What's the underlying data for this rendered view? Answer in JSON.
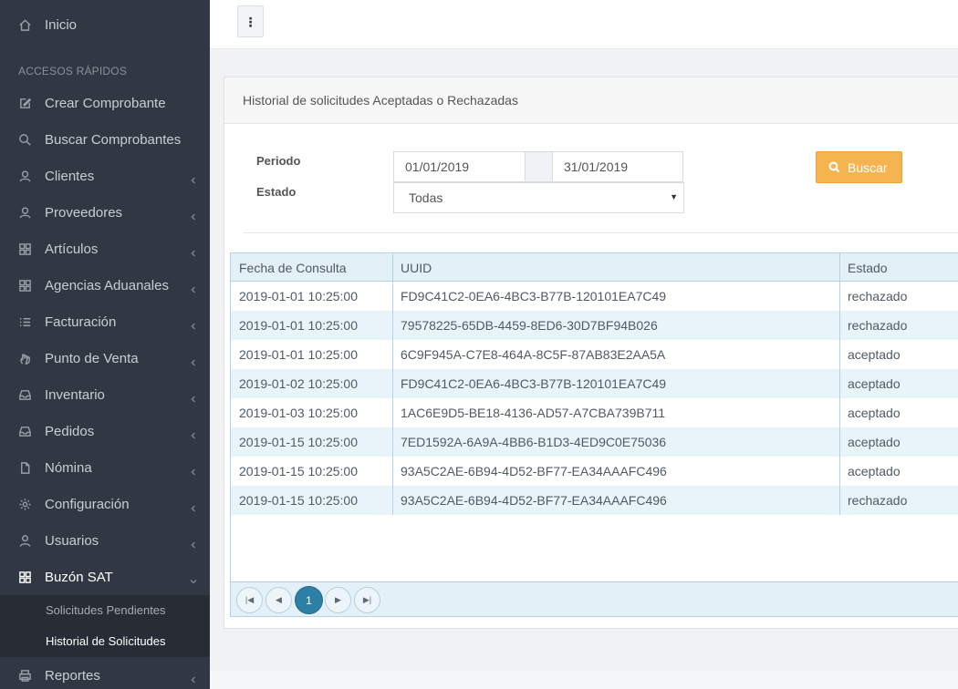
{
  "sidebar": {
    "top_item": {
      "label": "Inicio",
      "icon": "home-icon"
    },
    "section_title": "ACCESOS RÁPIDOS",
    "items": [
      {
        "label": "Crear Comprobante",
        "icon": "edit-icon",
        "chevron": false
      },
      {
        "label": "Buscar Comprobantes",
        "icon": "search-icon",
        "chevron": false
      },
      {
        "label": "Clientes",
        "icon": "users-icon",
        "chevron": true
      },
      {
        "label": "Proveedores",
        "icon": "users-icon",
        "chevron": true
      },
      {
        "label": "Artículos",
        "icon": "grid-icon",
        "chevron": true
      },
      {
        "label": "Agencias Aduanales",
        "icon": "grid-icon",
        "chevron": true
      },
      {
        "label": "Facturación",
        "icon": "list-icon",
        "chevron": true
      },
      {
        "label": "Punto de Venta",
        "icon": "hand-icon",
        "chevron": true
      },
      {
        "label": "Inventario",
        "icon": "inbox-icon",
        "chevron": true
      },
      {
        "label": "Pedidos",
        "icon": "inbox-icon",
        "chevron": true
      },
      {
        "label": "Nómina",
        "icon": "file-icon",
        "chevron": true
      },
      {
        "label": "Configuración",
        "icon": "gear-icon",
        "chevron": true
      },
      {
        "label": "Usuarios",
        "icon": "user-icon",
        "chevron": true
      },
      {
        "label": "Buzón SAT",
        "icon": "grid-icon",
        "chevron": true,
        "expanded": true
      }
    ],
    "submenu": [
      {
        "label": "Solicitudes Pendientes",
        "active": false
      },
      {
        "label": "Historial de Solicitudes",
        "active": true
      }
    ],
    "bottom_item": {
      "label": "Reportes",
      "icon": "printer-icon"
    }
  },
  "topbar": {
    "menu_icon": "vertical-dots-icon"
  },
  "panel": {
    "title": "Historial de solicitudes Aceptadas o Rechazadas",
    "form": {
      "periodo_label": "Periodo",
      "estado_label": "Estado",
      "fecha_inicio": "01/01/2019",
      "fecha_fin": "31/01/2019",
      "estado_value": "Todas",
      "search_button": "Buscar",
      "button_color": "#f6b451"
    },
    "table": {
      "columns": [
        "Fecha de Consulta",
        "UUID",
        "Estado"
      ],
      "rows": [
        [
          "2019-01-01 10:25:00",
          "FD9C41C2-0EA6-4BC3-B77B-120101EA7C49",
          "rechazado"
        ],
        [
          "2019-01-01 10:25:00",
          "79578225-65DB-4459-8ED6-30D7BF94B026",
          "rechazado"
        ],
        [
          "2019-01-01 10:25:00",
          "6C9F945A-C7E8-464A-8C5F-87AB83E2AA5A",
          "aceptado"
        ],
        [
          "2019-01-02 10:25:00",
          "FD9C41C2-0EA6-4BC3-B77B-120101EA7C49",
          "aceptado"
        ],
        [
          "2019-01-03 10:25:00",
          "1AC6E9D5-BE18-4136-AD57-A7CBA739B711",
          "aceptado"
        ],
        [
          "2019-01-15 10:25:00",
          "7ED1592A-6A9A-4BB6-B1D3-4ED9C0E75036",
          "aceptado"
        ],
        [
          "2019-01-15 10:25:00",
          "93A5C2AE-6B94-4D52-BF77-EA34AAAFC496",
          "aceptado"
        ],
        [
          "2019-01-15 10:25:00",
          "93A5C2AE-6B94-4D52-BF77-EA34AAAFC496",
          "rechazado"
        ]
      ]
    },
    "pager": {
      "current_page": "1"
    }
  }
}
